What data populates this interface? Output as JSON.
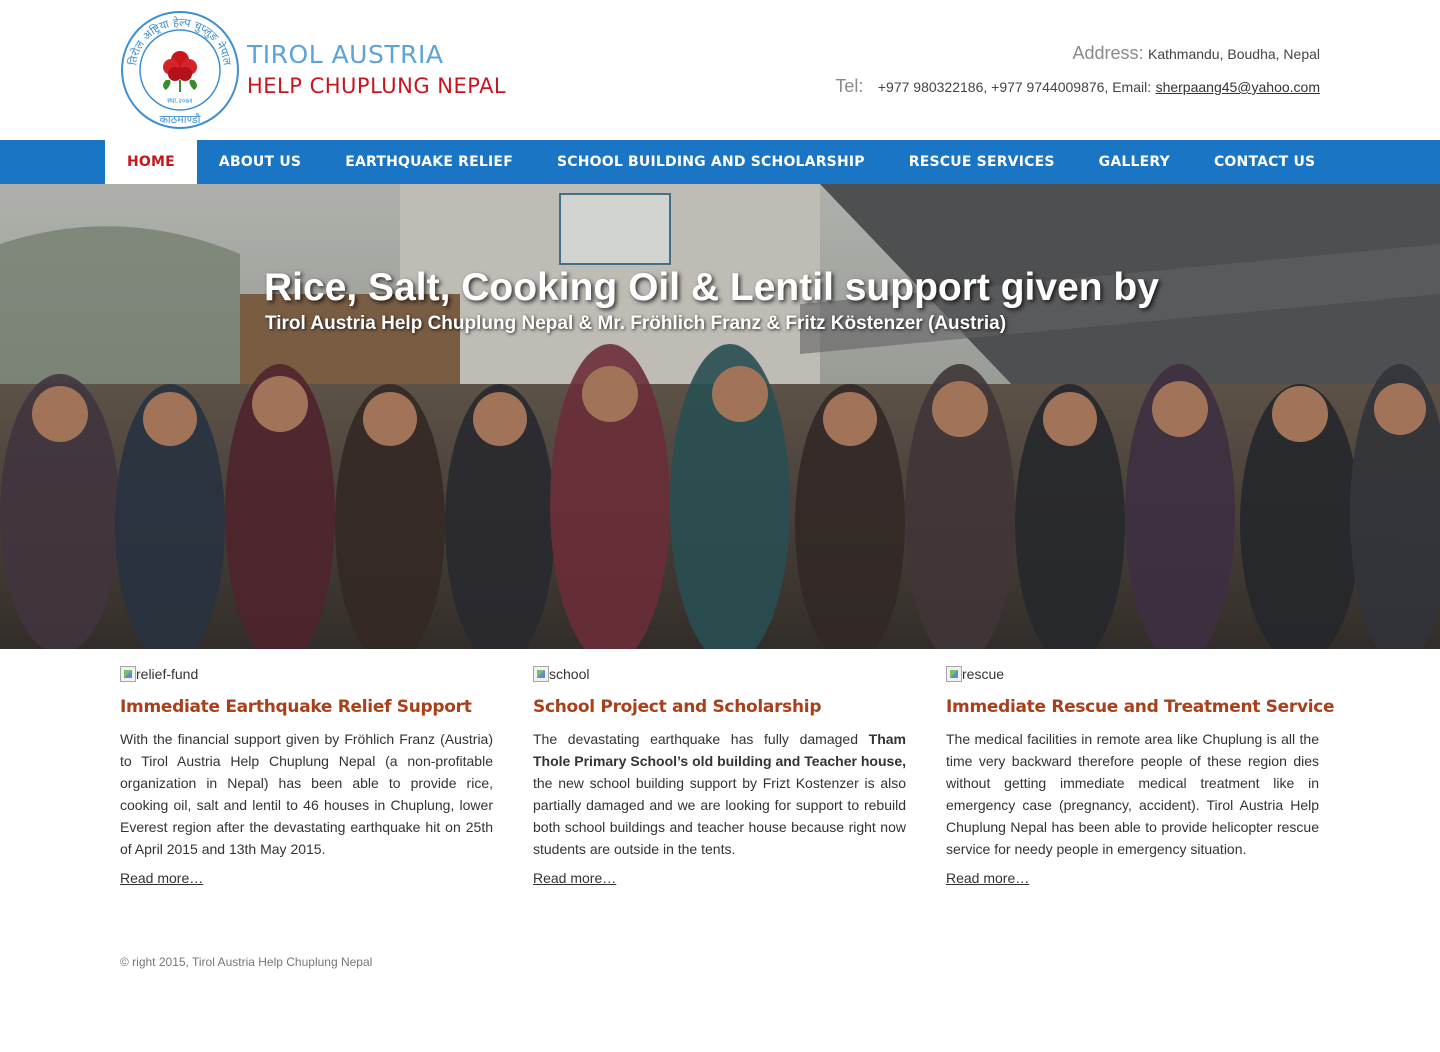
{
  "logo": {
    "line1": "TIROL AUSTRIA",
    "line2": "HELP CHUPLUNG NEPAL",
    "seal_text": "तिरोल अष्ट्रिया हेल्प चुप्लुङ नेपाल",
    "seal_year": "स्था.२०७१",
    "seal_city": "काठमाण्डौ"
  },
  "contact": {
    "address_label": "Address:",
    "address_value": "Kathmandu, Boudha, Nepal",
    "tel_label": "Tel:",
    "tel_value": "+977 980322186, +977 9744009876, Email:",
    "email": "sherpaang45@yahoo.com"
  },
  "nav": {
    "items": [
      "HOME",
      "ABOUT US",
      "EARTHQUAKE RELIEF",
      "SCHOOL BUILDING AND SCHOLARSHIP",
      "RESCUE SERVICES",
      "GALLERY",
      "CONTACT US"
    ],
    "active_index": 0
  },
  "hero": {
    "title": "Rice, Salt, Cooking Oil & Lentil support given by",
    "subtitle": "Tirol Austria Help Chuplung Nepal & Mr. Fröhlich Franz & Fritz Köstenzer (Austria)"
  },
  "features": [
    {
      "img_alt": "relief-fund",
      "title": "Immediate Earthquake Relief Support",
      "text": "With the financial support given by Fröhlich Franz (Austria) to Tirol Austria Help Chuplung Nepal (a non-profitable organization in Nepal) has been able to provide rice, cooking oil, salt and lentil to 46 houses in Chuplung, lower Everest region after the devastating earthquake hit on 25th of April 2015 and 13th May 2015.",
      "more": "Read more…"
    },
    {
      "img_alt": "school",
      "title": "School Project and Scholarship",
      "text_pre": "The devastating earthquake has fully damaged ",
      "text_bold": "Tham Thole Primary School’s old building and Teacher house,",
      "text_post": " the new school building support by Frizt Kostenzer is also partially damaged and we are looking for support to rebuild both school buildings and teacher house because right now students are outside in the tents.",
      "more": "Read more…"
    },
    {
      "img_alt": "rescue",
      "title": "Immediate Rescue and Treatment Service",
      "text": "The medical facilities in remote area like Chuplung is all the time very backward therefore people of these region dies without getting immediate medical treatment like in emergency case (pregnancy, accident). Tirol Austria Help Chuplung Nepal has been able to provide helicopter rescue service for needy people in emergency situation.",
      "more": "Read more…"
    }
  ],
  "footer": {
    "copyright": "© right 2015, Tirol Austria Help Chuplung Nepal"
  },
  "colors": {
    "nav_bg": "#1a75c4",
    "active_nav_text": "#c9151e",
    "logo_blue": "#5ba3d8",
    "logo_red": "#c9151e",
    "feature_title": "#a8401b"
  }
}
